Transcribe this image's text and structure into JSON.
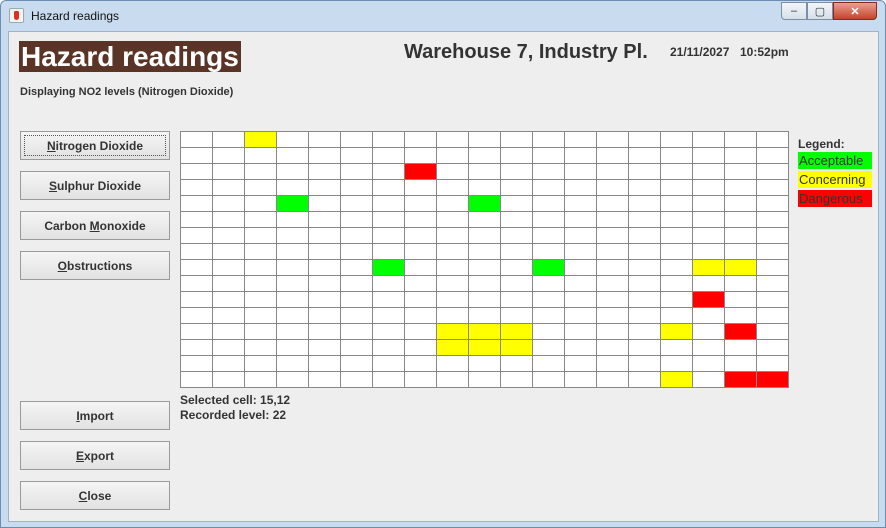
{
  "window": {
    "title": "Hazard readings",
    "controls": {
      "minimize": "–",
      "maximize": "▢",
      "close": "✕"
    }
  },
  "header": {
    "title": "Hazard readings",
    "location": "Warehouse 7, Industry Pl.",
    "date": "21/11/2027",
    "time": "10:52pm",
    "displaying": "Displaying NO2 levels (Nitrogen Dioxide)"
  },
  "buttons": {
    "nitrogen": {
      "pre": "",
      "key": "N",
      "post": "itrogen Dioxide"
    },
    "sulphur": {
      "pre": "",
      "key": "S",
      "post": "ulphur Dioxide"
    },
    "carbon": {
      "pre": "Carbon ",
      "key": "M",
      "post": "onoxide"
    },
    "obstructions": {
      "pre": "",
      "key": "O",
      "post": "bstructions"
    },
    "import": {
      "pre": "",
      "key": "I",
      "post": "mport"
    },
    "export": {
      "pre": "",
      "key": "E",
      "post": "xport"
    },
    "close": {
      "pre": "",
      "key": "C",
      "post": "lose"
    }
  },
  "legend": {
    "title": "Legend:",
    "items": [
      {
        "label": "Acceptable",
        "color": "#00ff00"
      },
      {
        "label": "Concerning",
        "color": "#ffff00"
      },
      {
        "label": "Dangerous",
        "color": "#ff0000"
      }
    ]
  },
  "colors": {
    "acceptable": "#00ff00",
    "concerning": "#ffff00",
    "dangerous": "#ff0000"
  },
  "grid": {
    "columns": 19,
    "rows": 16,
    "cells": [
      {
        "row": 0,
        "col": 2,
        "level": "concerning"
      },
      {
        "row": 2,
        "col": 7,
        "level": "dangerous"
      },
      {
        "row": 4,
        "col": 3,
        "level": "acceptable"
      },
      {
        "row": 4,
        "col": 9,
        "level": "acceptable"
      },
      {
        "row": 8,
        "col": 6,
        "level": "acceptable"
      },
      {
        "row": 8,
        "col": 11,
        "level": "acceptable"
      },
      {
        "row": 8,
        "col": 16,
        "level": "concerning"
      },
      {
        "row": 8,
        "col": 17,
        "level": "concerning"
      },
      {
        "row": 10,
        "col": 16,
        "level": "dangerous"
      },
      {
        "row": 12,
        "col": 8,
        "level": "concerning"
      },
      {
        "row": 12,
        "col": 9,
        "level": "concerning"
      },
      {
        "row": 12,
        "col": 10,
        "level": "concerning"
      },
      {
        "row": 12,
        "col": 15,
        "level": "concerning"
      },
      {
        "row": 12,
        "col": 17,
        "level": "dangerous"
      },
      {
        "row": 13,
        "col": 8,
        "level": "concerning"
      },
      {
        "row": 13,
        "col": 9,
        "level": "concerning"
      },
      {
        "row": 13,
        "col": 10,
        "level": "concerning"
      },
      {
        "row": 15,
        "col": 15,
        "level": "concerning"
      },
      {
        "row": 15,
        "col": 17,
        "level": "dangerous"
      },
      {
        "row": 15,
        "col": 18,
        "level": "dangerous"
      }
    ]
  },
  "status": {
    "selected": "Selected cell: 15,12",
    "level": "Recorded level: 22"
  }
}
